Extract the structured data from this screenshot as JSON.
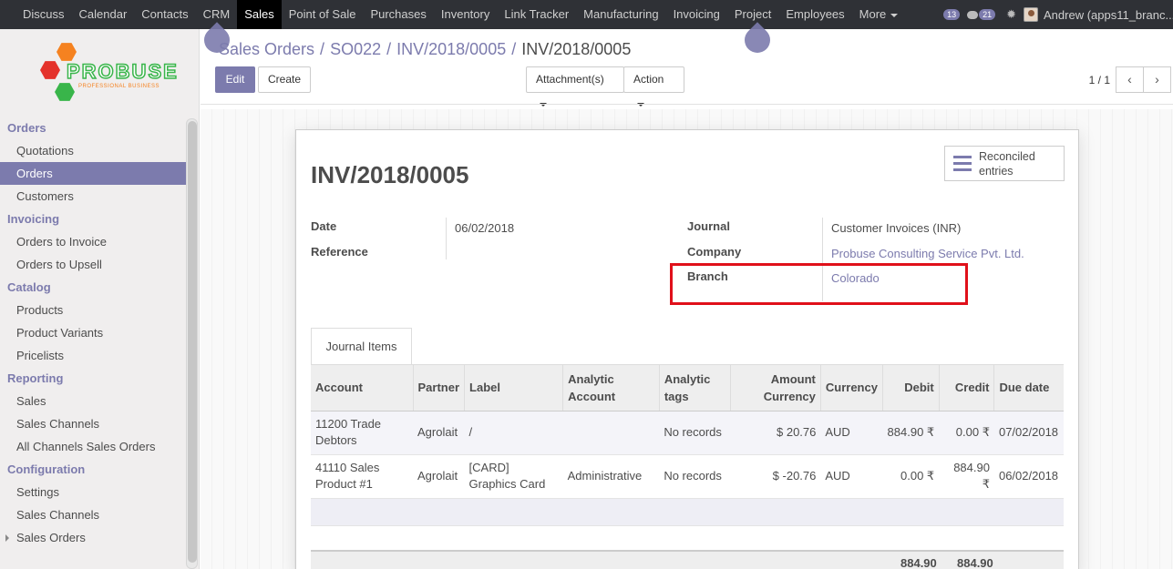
{
  "topbar": {
    "menu": [
      "Discuss",
      "Calendar",
      "Contacts",
      "CRM",
      "Sales",
      "Point of Sale",
      "Purchases",
      "Inventory",
      "Link Tracker",
      "Manufacturing",
      "Invoicing",
      "Project",
      "Employees",
      "More"
    ],
    "active": "Sales",
    "messages_count": "13",
    "chat_count": "21",
    "user": "Andrew (apps11_branc..."
  },
  "logo": {
    "brand": "PROBUSE",
    "tagline": "PROFESSIONAL BUSINESS"
  },
  "sidebar": {
    "sections": [
      {
        "title": "Orders",
        "items": [
          "Quotations",
          "Orders",
          "Customers"
        ]
      },
      {
        "title": "Invoicing",
        "items": [
          "Orders to Invoice",
          "Orders to Upsell"
        ]
      },
      {
        "title": "Catalog",
        "items": [
          "Products",
          "Product Variants",
          "Pricelists"
        ]
      },
      {
        "title": "Reporting",
        "items": [
          "Sales",
          "Sales Channels",
          "All Channels Sales Orders"
        ]
      },
      {
        "title": "Configuration",
        "items": [
          "Settings",
          "Sales Channels",
          "Sales Orders"
        ]
      }
    ],
    "active_item": "Orders"
  },
  "breadcrumb": {
    "items": [
      "Sales Orders",
      "SO022",
      "INV/2018/0005"
    ],
    "current": "INV/2018/0005"
  },
  "toolbar": {
    "edit": "Edit",
    "create": "Create",
    "attachments": "Attachment(s)",
    "action": "Action",
    "pager": "1 / 1"
  },
  "form": {
    "smart_button": "Reconciled entries",
    "title": "INV/2018/0005",
    "date_label": "Date",
    "date_value": "06/02/2018",
    "reference_label": "Reference",
    "journal_label": "Journal",
    "journal_value": "Customer Invoices (INR)",
    "company_label": "Company",
    "company_value": "Probuse Consulting Service Pvt. Ltd.",
    "branch_label": "Branch",
    "branch_value": "Colorado",
    "tab": "Journal Items"
  },
  "table": {
    "headers": [
      "Account",
      "Partner",
      "Label",
      "Analytic Account",
      "Analytic tags",
      "Amount Currency",
      "Currency",
      "Debit",
      "Credit",
      "Due date"
    ],
    "rows": [
      [
        "11200 Trade Debtors",
        "Agrolait",
        "/",
        "",
        "No records",
        "$ 20.76",
        "AUD",
        "884.90 ₹",
        "0.00 ₹",
        "07/02/2018"
      ],
      [
        "41110 Sales Product #1",
        "Agrolait",
        "[CARD] Graphics Card",
        "Administrative",
        "No records",
        "$ -20.76",
        "AUD",
        "0.00 ₹",
        "884.90 ₹",
        "06/02/2018"
      ]
    ],
    "total_debit": "884.90",
    "total_credit": "884.90"
  },
  "colors": {
    "accent": "#7c7bad",
    "topbar": "#2f3136",
    "highlight": "#e0101a"
  }
}
